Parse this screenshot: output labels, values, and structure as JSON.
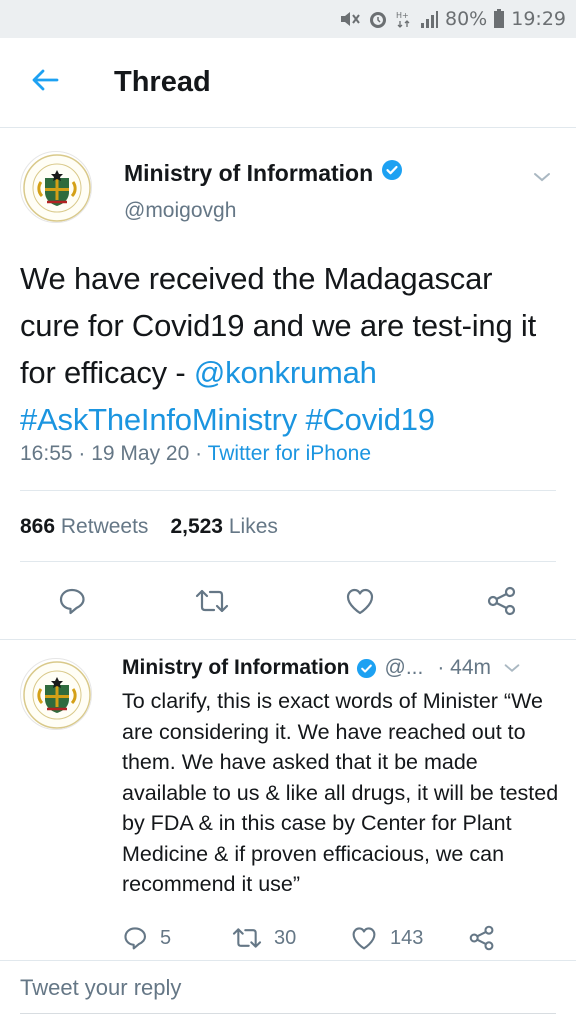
{
  "status_bar": {
    "battery": "80%",
    "time": "19:29"
  },
  "header": {
    "title": "Thread"
  },
  "main_tweet": {
    "author_name": "Ministry of Information",
    "author_handle": "@moigovgh",
    "text_plain": "We have received the Madagascar cure for Covid19 and we are test-ing it for efficacy - ",
    "mention": "@konkrumah",
    "hashtag1": "#AskTheInfoMinistry",
    "hashtag2": "#Covid19",
    "time": "16:55",
    "date": "19 May 20",
    "source": "Twitter for iPhone",
    "retweets_count": "866",
    "retweets_label": "Retweets",
    "likes_count": "2,523",
    "likes_label": "Likes"
  },
  "reply_tweet": {
    "author_name": "Ministry of Information",
    "author_handle": "@...",
    "time": "· 44m",
    "text": "To clarify, this is exact words of Minister “We are considering it. We have reached out to them. We have asked that it be made available to us & like all drugs, it will be tested by FDA & in this case by Center for Plant Medicine & if proven efficacious, we can recommend it use”",
    "reply_count": "5",
    "retweet_count": "30",
    "like_count": "143"
  },
  "reply_box": {
    "placeholder": "Tweet your reply"
  },
  "colors": {
    "accent": "#1da1f2",
    "link": "#1b95e0",
    "secondary_text": "#657786",
    "divider": "#e1e8ed"
  },
  "icons": [
    "mute-icon",
    "alarm-icon",
    "data-icon",
    "signal-icon",
    "battery-icon",
    "back-arrow-icon",
    "verified-icon",
    "chevron-down-icon",
    "reply-icon",
    "retweet-icon",
    "like-icon",
    "share-icon",
    "ghana-coat-of-arms-logo"
  ]
}
